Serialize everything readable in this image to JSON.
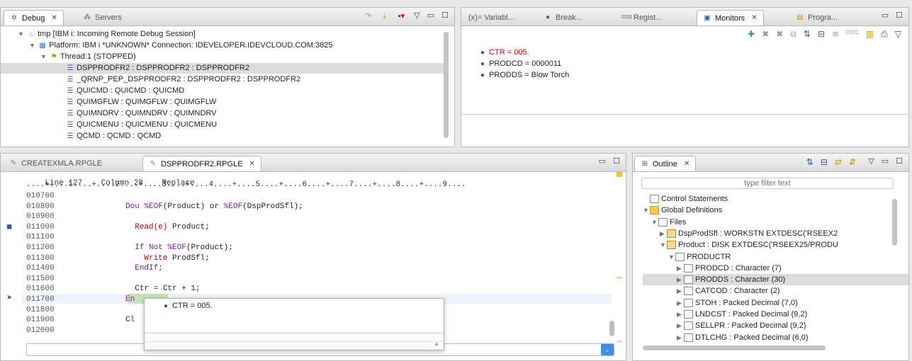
{
  "debug_view": {
    "tabs": [
      {
        "label": "Debug"
      },
      {
        "label": "Servers"
      }
    ],
    "tree": [
      {
        "text": "tmp [IBM i: Incoming Remote Debug Session]"
      },
      {
        "text": "Platform: IBM i *UNKNOWN*   Connection: IDEVELOPER.IDEVCLOUD.COM:3825"
      },
      {
        "text": "Thread:1 (STOPPED)"
      },
      {
        "text": "DSPPRODFR2 : DSPPRODFR2 : DSPPRODFR2"
      },
      {
        "text": "_QRNP_PEP_DSPPRODFR2 : DSPPRODFR2 : DSPPRODFR2"
      },
      {
        "text": "QUICMD : QUICMD : QUICMD"
      },
      {
        "text": "QUIMGFLW : QUIMGFLW : QUIMGFLW"
      },
      {
        "text": "QUIMNDRV : QUIMNDRV : QUIMNDRV"
      },
      {
        "text": "QUICMENU : QUICMENU : QUICMENU"
      },
      {
        "text": "QCMD : QCMD : QCMD"
      }
    ]
  },
  "monitors_view": {
    "tabs": [
      {
        "label": "(x)= Variabl..."
      },
      {
        "label": "Break..."
      },
      {
        "label": "Regist..."
      },
      {
        "label": "Monitors"
      },
      {
        "label": "Progra..."
      }
    ],
    "items": [
      {
        "text": "CTR = 005.",
        "color": "#d40000"
      },
      {
        "text": "PRODCD = 0000011",
        "color": "#222222"
      },
      {
        "text": "PRODDS = Blow Torch",
        "color": "#222222"
      }
    ]
  },
  "editor": {
    "tabs": [
      {
        "label": "CREATEXMLA.RPGLE"
      },
      {
        "label": "DSPPRODFR2.RPGLE"
      }
    ],
    "status": {
      "line": "Line 127",
      "column": "Column 28",
      "mode": "Replace"
    },
    "ruler": "....+....1....+....2....+....3....+....4....+....5....+....6....+....7....+....8....+....9....",
    "line_numbers": [
      "010700",
      "010800",
      "010900",
      "011000",
      "011100",
      "011200",
      "011300",
      "011400",
      "011500",
      "011600",
      "011700",
      "011800",
      "011900",
      "012000"
    ],
    "code": [
      {
        "parts": [],
        "indent": ""
      },
      {
        "parts": [
          {
            "t": "Dou ",
            "c": "kw"
          },
          {
            "t": "%EOF",
            "c": "bif"
          },
          {
            "t": "(Product) or ",
            "c": ""
          },
          {
            "t": "%EOF",
            "c": "bif"
          },
          {
            "t": "(DspProdSfl);",
            "c": ""
          }
        ],
        "indent": "          "
      },
      {
        "parts": [],
        "indent": ""
      },
      {
        "parts": [
          {
            "t": "Read(e)",
            "c": "fn"
          },
          {
            "t": " Product;",
            "c": ""
          }
        ],
        "indent": "            "
      },
      {
        "parts": [],
        "indent": ""
      },
      {
        "parts": [
          {
            "t": "If Not ",
            "c": "kw"
          },
          {
            "t": "%EOF",
            "c": "bif"
          },
          {
            "t": "(Product);",
            "c": ""
          }
        ],
        "indent": "            "
      },
      {
        "parts": [
          {
            "t": "Write",
            "c": "fn"
          },
          {
            "t": " ProdSfl;",
            "c": ""
          }
        ],
        "indent": "              "
      },
      {
        "parts": [
          {
            "t": "EndIf;",
            "c": "kw"
          }
        ],
        "indent": "            "
      },
      {
        "parts": [],
        "indent": ""
      },
      {
        "parts": [
          {
            "t": "Ctr = Ctr + 1;",
            "c": ""
          }
        ],
        "indent": "            "
      },
      {
        "parts": [
          {
            "t": "En",
            "c": "kw"
          }
        ],
        "indent": "          "
      },
      {
        "parts": [],
        "indent": ""
      },
      {
        "parts": [
          {
            "t": "Cl",
            "c": "fn"
          }
        ],
        "indent": "          "
      },
      {
        "parts": [],
        "indent": ""
      }
    ],
    "hover_popup": {
      "text": "CTR = 005."
    }
  },
  "outline_view": {
    "tab": "Outline",
    "filter_placeholder": "type filter text",
    "items": [
      {
        "text": "Control Statements",
        "level": 0,
        "arrow": ""
      },
      {
        "text": "Global Definitions",
        "level": 0,
        "arrow": "▼"
      },
      {
        "text": "Files",
        "level": 1,
        "arrow": "▼"
      },
      {
        "text": "DspProdSfl : WORKSTN EXTDESC('RSEEX2",
        "level": 2,
        "arrow": "▶"
      },
      {
        "text": "Product : DISK EXTDESC('RSEEX25/PRODU",
        "level": 2,
        "arrow": "▼"
      },
      {
        "text": "PRODUCTR",
        "level": 3,
        "arrow": "▼"
      },
      {
        "text": "PRODCD : Character (7)",
        "level": 4,
        "arrow": "▶"
      },
      {
        "text": "PRODDS : Character (30)",
        "level": 4,
        "arrow": "▶"
      },
      {
        "text": "CATCOD : Character (2)",
        "level": 4,
        "arrow": "▶"
      },
      {
        "text": "STOH : Packed Decimal (7,0)",
        "level": 4,
        "arrow": "▶"
      },
      {
        "text": "LNDCST : Packed Decimal (9,2)",
        "level": 4,
        "arrow": "▶"
      },
      {
        "text": "SELLPR : Packed Decimal (9,2)",
        "level": 4,
        "arrow": "▶"
      },
      {
        "text": "DTLCHG : Packed Decimal (6,0)",
        "level": 4,
        "arrow": "▶"
      }
    ]
  }
}
